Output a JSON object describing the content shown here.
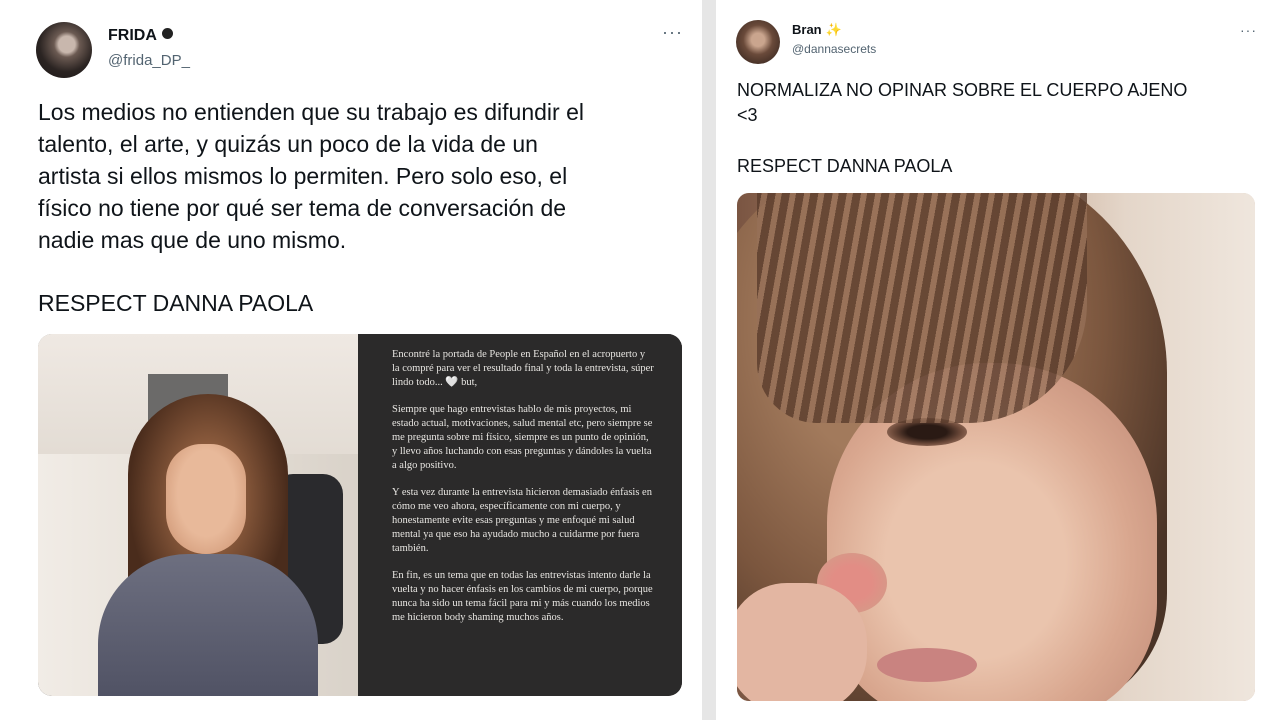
{
  "tweet1": {
    "user": {
      "name": "FRIDA",
      "handle": "@frida_DP_"
    },
    "more_label": "···",
    "text_lines": [
      "Los medios no entienden que su trabajo es difundir el",
      "talento, el arte, y quizás un poco de la vida de un",
      "artista si ellos mismos lo permiten. Pero solo eso, el",
      "físico no tiene por qué ser tema de conversación de",
      "nadie mas que de uno mismo."
    ],
    "respect": "RESPECT DANNA PAOLA",
    "story_paragraphs": [
      "Encontré la portada de People en Español en el acropuerto y la compré para ver el resultado final y toda la entrevista, súper lindo todo... 🤍 but,",
      "Siempre que hago entrevistas hablo de mis proyectos, mi estado actual, motivaciones, salud mental etc, pero siempre se me pregunta sobre mi físico, siempre es un punto de opinión, y llevo años luchando con esas preguntas y dándoles la vuelta a algo positivo.",
      "Y esta vez durante la entrevista hicieron demasiado énfasis en cómo me veo ahora, específicamente con mi cuerpo, y honestamente evite esas preguntas y me enfoqué mi salud mental ya que eso ha ayudado mucho a cuidarme por fuera también.",
      "En fin, es un tema que en todas las entrevistas intento darle la vuelta y no hacer énfasis en los cambios de mi cuerpo, porque nunca ha sido un tema fácil para mi y más cuando los medios me hicieron body shaming muchos años."
    ]
  },
  "tweet2": {
    "user": {
      "name": "Bran",
      "handle": "@dannasecrets"
    },
    "more_label": "···",
    "text_line1": "NORMALIZA NO OPINAR SOBRE EL CUERPO AJENO",
    "text_line2": "<3",
    "respect": "RESPECT DANNA PAOLA"
  },
  "colors": {
    "text": "#0f1419",
    "secondary": "#536471",
    "story_bg": "#2b2a2a"
  },
  "icons": {
    "verified": "verified-badge-icon",
    "sparkle": "sparkles-icon",
    "more": "more-options-icon"
  }
}
